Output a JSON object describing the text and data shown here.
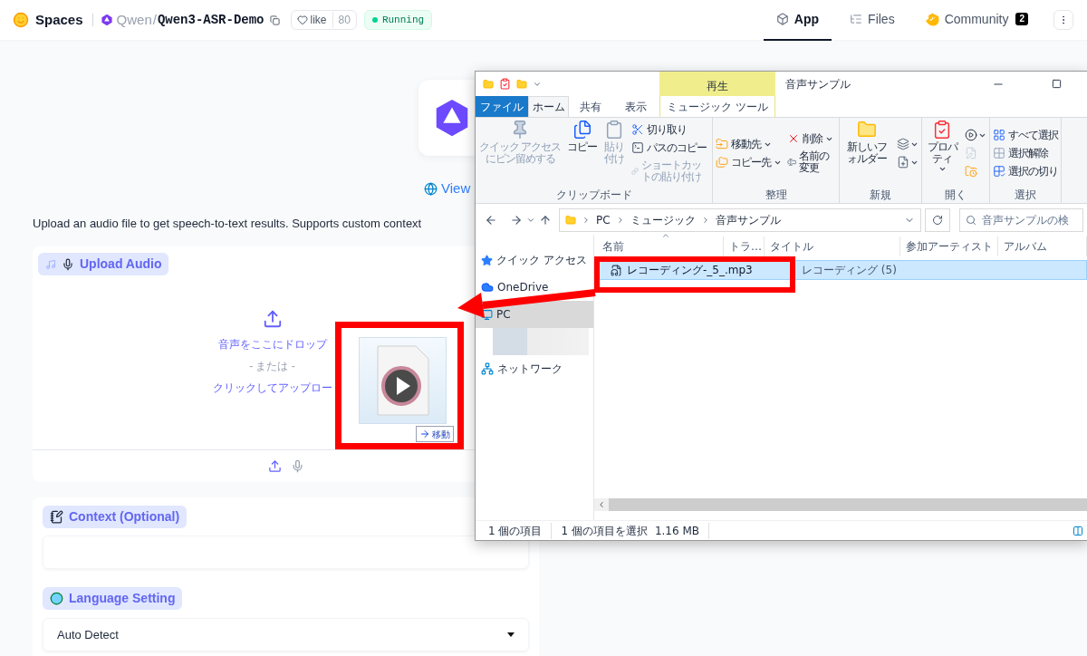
{
  "header": {
    "brand": "Spaces",
    "owner": "Qwen",
    "separator": "/",
    "repo": "Qwen3-ASR-Demo",
    "like_label": "like",
    "like_count": "80",
    "status": "Running",
    "tabs": [
      {
        "label": "App",
        "selected": true
      },
      {
        "label": "Files",
        "selected": false
      },
      {
        "label": "Community",
        "selected": false,
        "badge": "2"
      }
    ]
  },
  "app": {
    "view_link": "View",
    "description": "Upload an audio file to get speech-to-text results. Supports custom context",
    "upload": {
      "label": "Upload Audio",
      "drop_text": "音声をここにドロップ",
      "or_text": "- または -",
      "click_text": "クリックしてアップロー"
    },
    "context": {
      "label": "Context (Optional)"
    },
    "language": {
      "label": "Language Setting",
      "value": "Auto Detect"
    }
  },
  "explorer": {
    "contextual_tab": "再生",
    "title": "音声サンプル",
    "tabs": [
      {
        "label": "ファイル",
        "kind": "file",
        "selected": false
      },
      {
        "label": "ホーム",
        "kind": "tab",
        "selected": true
      },
      {
        "label": "共有",
        "kind": "tab",
        "selected": false
      },
      {
        "label": "表示",
        "kind": "tab",
        "selected": false
      },
      {
        "label": "ミュージック ツール",
        "kind": "contextual",
        "selected": false
      }
    ],
    "ribbon": [
      {
        "name": "クリップボード",
        "columns": [
          [
            {
              "kind": "large",
              "label": "クイック アクセスにピン留めする",
              "disabled": true,
              "dropdown": false
            }
          ],
          [
            {
              "kind": "large",
              "label": "コピー",
              "disabled": false,
              "dropdown": false
            }
          ],
          [
            {
              "kind": "large",
              "label": "貼り付け",
              "disabled": true,
              "dropdown": false
            }
          ],
          [
            {
              "kind": "small",
              "label": "切り取り",
              "disabled": false,
              "dropdown": false
            },
            {
              "kind": "small",
              "label": "パスのコピー",
              "disabled": false,
              "dropdown": false
            },
            {
              "kind": "small",
              "label": "ショートカットの貼り付け",
              "disabled": true,
              "dropdown": false
            }
          ]
        ]
      },
      {
        "name": "整理",
        "columns": [
          [
            {
              "kind": "small",
              "label": "移動先",
              "disabled": false,
              "dropdown": true
            },
            {
              "kind": "small",
              "label": "コピー先",
              "disabled": false,
              "dropdown": true
            }
          ],
          [
            {
              "kind": "small",
              "label": "削除",
              "disabled": false,
              "dropdown": true
            },
            {
              "kind": "small",
              "label": "名前の変更",
              "disabled": false,
              "dropdown": false
            }
          ]
        ]
      },
      {
        "name": "新規",
        "columns": [
          [
            {
              "kind": "large",
              "label": "新しいフォルダー",
              "disabled": false,
              "dropdown": false
            }
          ],
          [
            {
              "kind": "icon",
              "disabled": false,
              "dropdown": true
            },
            {
              "kind": "icon",
              "disabled": false,
              "dropdown": true
            }
          ]
        ]
      },
      {
        "name": "開く",
        "columns": [
          [
            {
              "kind": "large",
              "label": "プロパティ",
              "disabled": false,
              "dropdown": true
            }
          ],
          [
            {
              "kind": "icon",
              "disabled": false,
              "dropdown": true
            },
            {
              "kind": "icon",
              "disabled": true,
              "dropdown": false
            },
            {
              "kind": "icon",
              "disabled": false,
              "dropdown": false
            }
          ]
        ]
      },
      {
        "name": "選択",
        "columns": [
          [
            {
              "kind": "small",
              "label": "すべて選択",
              "disabled": false,
              "dropdown": false
            },
            {
              "kind": "small",
              "label": "選択解除",
              "disabled": false,
              "dropdown": false
            },
            {
              "kind": "small",
              "label": "選択の切り",
              "disabled": false,
              "dropdown": false
            }
          ]
        ]
      }
    ],
    "path": [
      "PC",
      "ミュージック",
      "音声サンプル"
    ],
    "search_placeholder": "音声サンプルの検",
    "nav": [
      {
        "kind": "location",
        "label": "クイック アクセス",
        "selected": false
      },
      {
        "kind": "location",
        "label": "OneDrive",
        "selected": false
      },
      {
        "kind": "location",
        "label": "PC",
        "selected": true
      },
      {
        "kind": "redacted"
      },
      {
        "kind": "location",
        "label": "ネットワーク",
        "selected": false
      }
    ],
    "columns": [
      "名前",
      "トラ…",
      "タイトル",
      "参加アーティスト",
      "アルバム"
    ],
    "files": [
      {
        "name": "レコーディング-_5_.mp3",
        "title": "レコーディング (5)",
        "selected": true
      }
    ],
    "status": {
      "count": "1 個の項目",
      "selection": "1 個の項目を選択",
      "size": "1.16 MB"
    }
  },
  "drag": {
    "action": "移動"
  }
}
